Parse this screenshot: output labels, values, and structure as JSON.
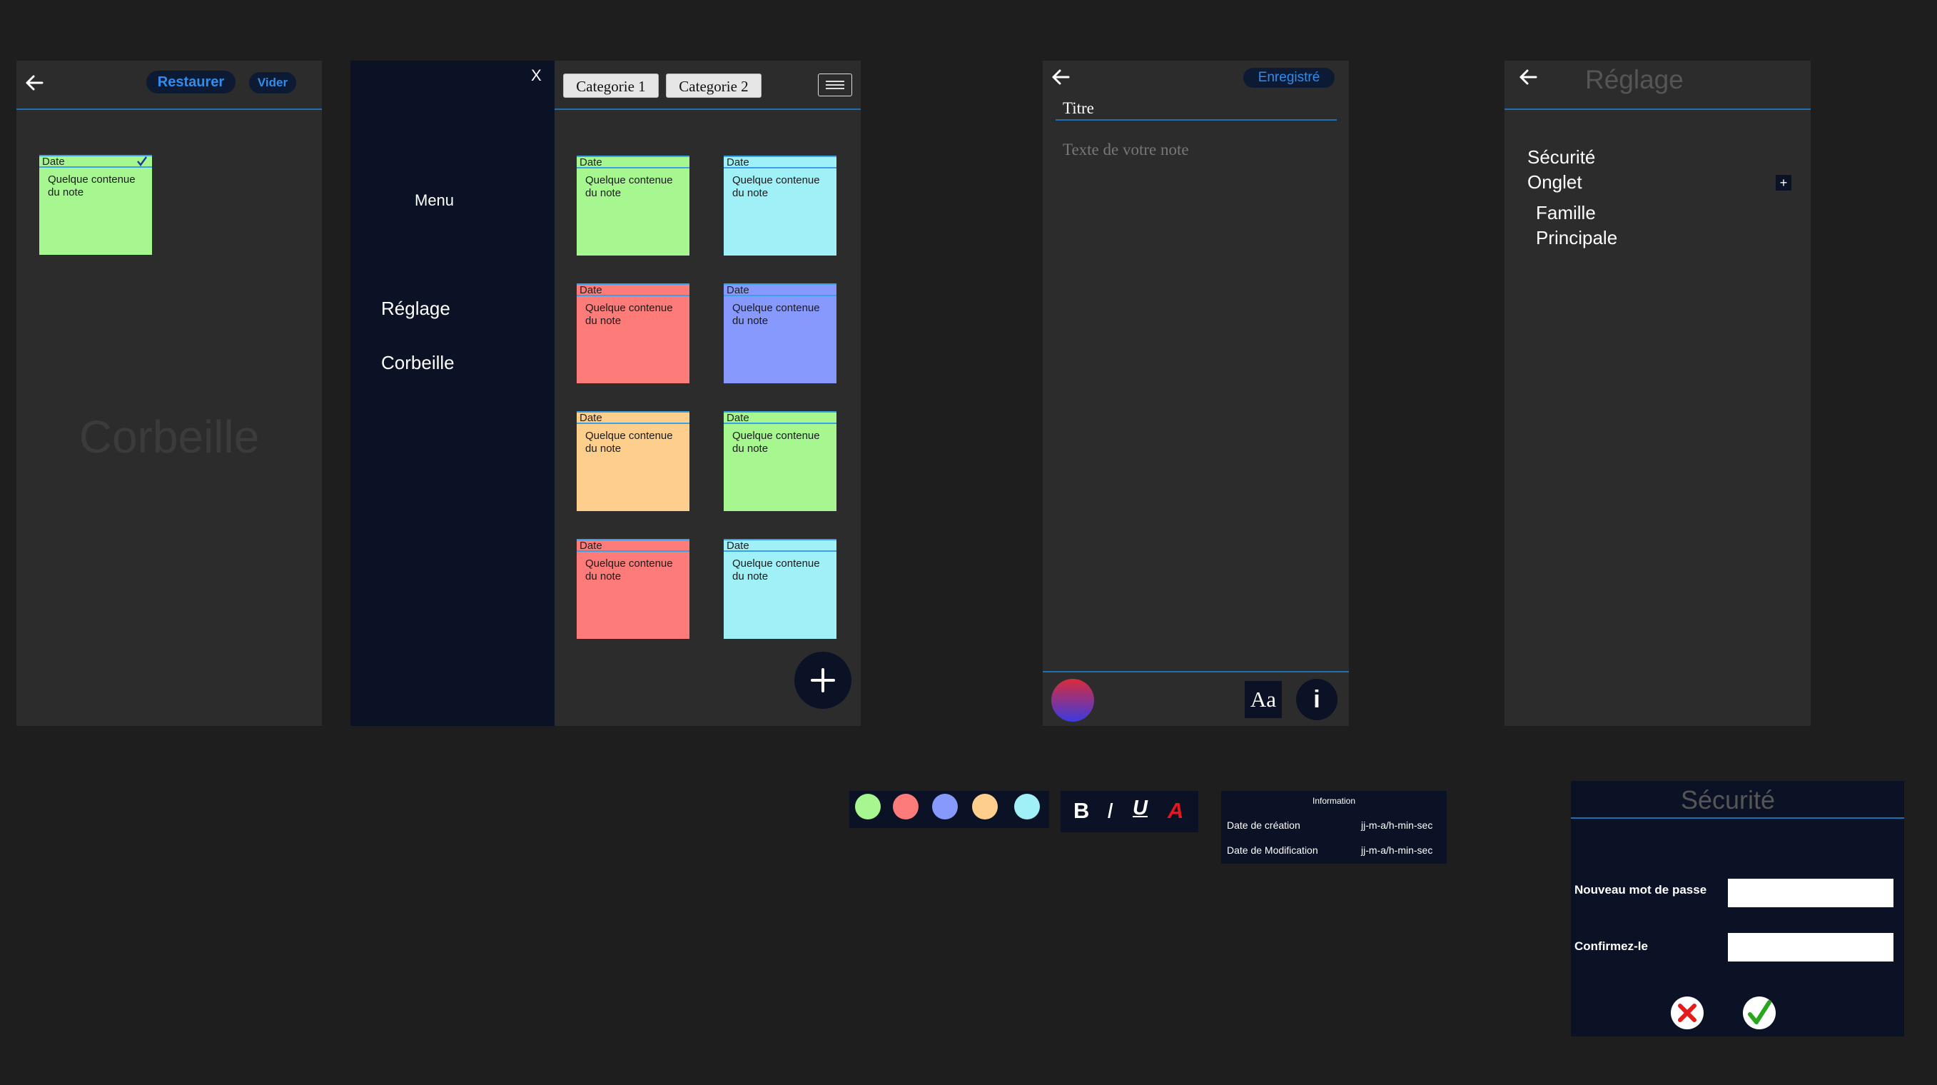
{
  "trash_screen": {
    "restore_label": "Restaurer",
    "empty_label": "Vider",
    "watermark": "Corbeille",
    "note": {
      "date": "Date",
      "content": "Quelque contenue du note",
      "color": "#a6f78f",
      "selected": true
    }
  },
  "drawer": {
    "close_label": "X",
    "menu_title": "Menu",
    "items": [
      {
        "label": "Réglage"
      },
      {
        "label": "Corbeille"
      }
    ]
  },
  "home_screen": {
    "categories": [
      "Categorie 1",
      "Categorie 2"
    ],
    "notes": [
      {
        "date": "Date",
        "content": "Quelque contenue du note",
        "color": "#a6f78f"
      },
      {
        "date": "Date",
        "content": "Quelque contenue du note",
        "color": "#9ff0f7"
      },
      {
        "date": "Date",
        "content": "Quelque contenue du note",
        "color": "#fd7b79"
      },
      {
        "date": "Date",
        "content": "Quelque contenue du note",
        "color": "#8799fd"
      },
      {
        "date": "Date",
        "content": "Quelque contenue du note",
        "color": "#fecf8c"
      },
      {
        "date": "Date",
        "content": "Quelque contenue du note",
        "color": "#a6f78f"
      },
      {
        "date": "Date",
        "content": "Quelque contenue du note",
        "color": "#fd7b79"
      },
      {
        "date": "Date",
        "content": "Quelque contenue du note",
        "color": "#9ff0f7"
      }
    ],
    "add_label": "+"
  },
  "editor_screen": {
    "saved_label": "Enregistré",
    "title_placeholder": "Titre",
    "body_placeholder": "Texte de votre note",
    "font_button_label": "Aa",
    "info_button_label": "i"
  },
  "settings_screen": {
    "title": "Réglage",
    "security_label": "Sécurité",
    "tabs_label": "Onglet",
    "add_tab_label": "+",
    "tabs": [
      "Famille",
      "Principale"
    ]
  },
  "color_palette": {
    "colors": [
      "#a6f78f",
      "#fd7b79",
      "#8799fd",
      "#fecf8c",
      "#9ff0f7"
    ]
  },
  "format_toolbar": {
    "bold": "B",
    "italic": "I",
    "underline": "U",
    "color": "A",
    "color_value": "#e8161b"
  },
  "info_panel": {
    "title": "Information",
    "rows": [
      {
        "label": "Date de création",
        "value": "jj-m-a/h-min-sec"
      },
      {
        "label": "Date de Modification",
        "value": "jj-m-a/h-min-sec"
      }
    ]
  },
  "security_dialog": {
    "title": "Sécurité",
    "new_password_label": "Nouveau mot de passe",
    "confirm_label": "Confirmez-le",
    "cancel_icon": "cross-icon",
    "confirm_icon": "check-icon"
  },
  "colors": {
    "accent": "#2f8df0",
    "divider": "#1f6fb3",
    "screen_bg": "#2c2c2c",
    "navy": "#0b1226"
  }
}
